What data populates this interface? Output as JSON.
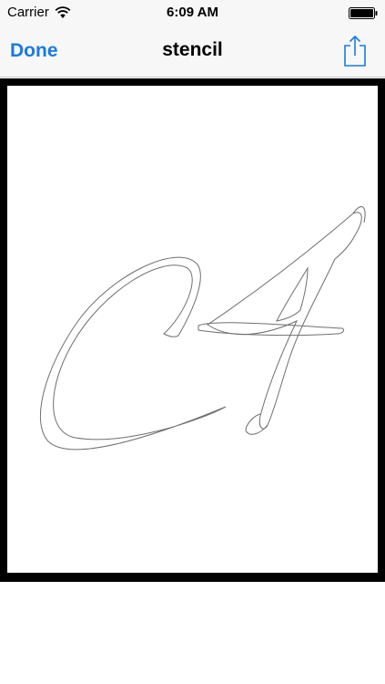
{
  "status_bar": {
    "carrier": "Carrier",
    "time": "6:09 AM",
    "wifi_icon": "wifi-icon",
    "battery_icon": "battery-icon"
  },
  "nav_bar": {
    "done_label": "Done",
    "title": "stencil",
    "share_icon": "share-icon",
    "accent_color": "#1a7ae2"
  },
  "stencil": {
    "art_icon": "script-letters-outline"
  }
}
